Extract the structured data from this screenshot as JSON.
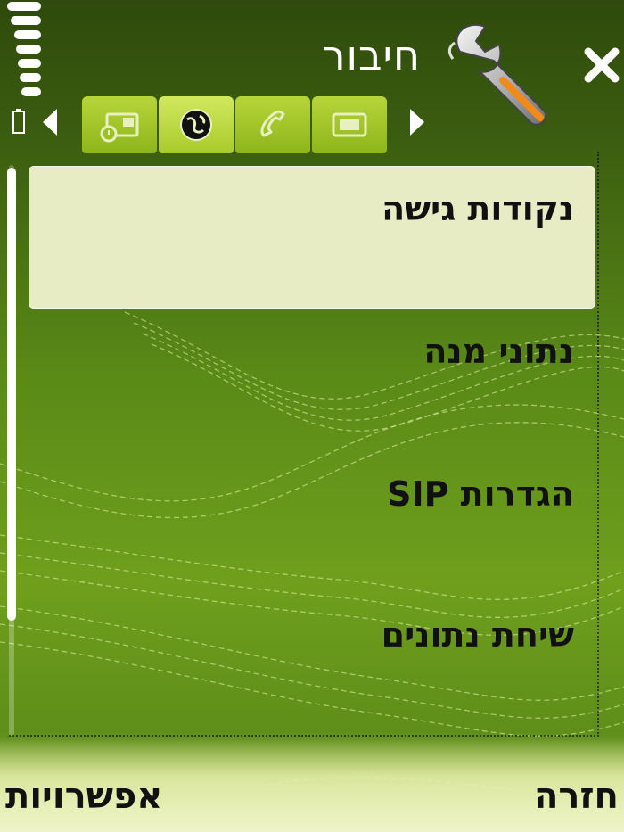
{
  "header": {
    "title": "חיבור",
    "app_icon": "wrench-icon",
    "close_icon": "close-icon"
  },
  "status": {
    "signal_icon": "signal-strength-icon",
    "battery_icon": "battery-icon"
  },
  "tabs": [
    {
      "icon": "device-icon",
      "active": false
    },
    {
      "icon": "globe-icon",
      "active": true
    },
    {
      "icon": "phone-icon",
      "active": false
    },
    {
      "icon": "screen-icon",
      "active": false
    }
  ],
  "list": {
    "items": [
      {
        "label": "נקודות גישה",
        "selected": true
      },
      {
        "label": "נתוני מנה",
        "selected": false
      },
      {
        "label": "הגדרות SIP",
        "selected": false
      },
      {
        "label": "שיחת נתונים",
        "selected": false
      }
    ]
  },
  "softkeys": {
    "left": "אפשרויות",
    "right": "חזרה"
  },
  "colors": {
    "background_top": "#2f4a0c",
    "background_mid": "#6f9f1c",
    "tab_active": "#d2e860",
    "selection": "#e8ecc4"
  }
}
